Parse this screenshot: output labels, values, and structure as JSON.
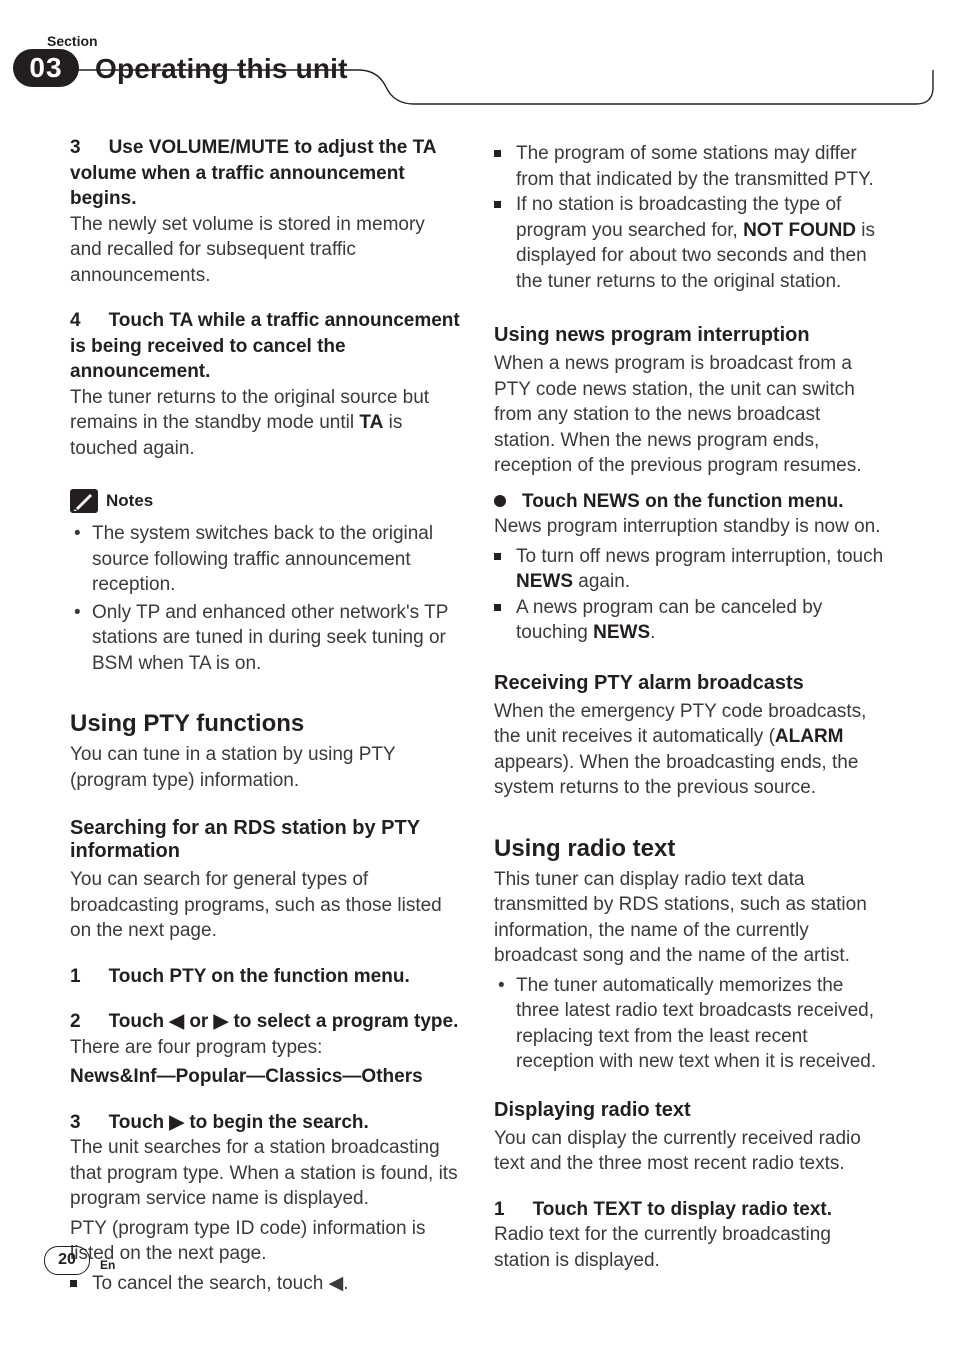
{
  "header": {
    "section_label": "Section",
    "section_number": "03",
    "title": "Operating this unit"
  },
  "left": {
    "step3_head": "Use VOLUME/MUTE to adjust the TA volume when a traffic announcement begins.",
    "step3_body": "The newly set volume is stored in memory and recalled for subsequent traffic announcements.",
    "step4_head": "Touch TA while a traffic announcement is being received to cancel the announcement.",
    "step4_body_a": "The tuner returns to the original source but remains in the standby mode until ",
    "step4_body_b": "TA",
    "step4_body_c": " is touched again.",
    "notes_label": "Notes",
    "notes": [
      "The system switches back to the original source following traffic announcement reception.",
      "Only TP and enhanced other network's TP stations are tuned in during seek tuning or BSM when TA is on."
    ],
    "h2_pty": "Using PTY functions",
    "pty_intro": "You can tune in a station by using PTY (program type) information.",
    "h3_search": "Searching for an RDS station by PTY information",
    "search_intro": "You can search for general types of broadcasting programs, such as those listed on the next page.",
    "s1": "Touch PTY on the function menu.",
    "s2": "Touch ◀ or ▶ to select a program type.",
    "s2_body": "There are four program types:",
    "s2_types": "News&Inf—Popular—Classics—Others",
    "s3": "Touch ▶ to begin the search.",
    "s3_body": "The unit searches for a station broadcasting that program type. When a station is found, its program service name is displayed.",
    "s3_body2": "PTY (program type ID code) information is listed on the next page.",
    "s3_cancel": "To cancel the search, touch ◀."
  },
  "right": {
    "sq1": "The program of some stations may differ from that indicated by the transmitted PTY.",
    "sq2_a": "If no station is broadcasting the type of program you searched for, ",
    "sq2_b": "NOT FOUND",
    "sq2_c": " is displayed for about two seconds and then the tuner returns to the original station.",
    "h3_news": "Using news program interruption",
    "news_body": "When a news program is broadcast from a PTY code news station, the unit can switch from any station to the news broadcast station. When the news program ends, reception of the previous program resumes.",
    "bb_news": "Touch NEWS on the function menu.",
    "news_after": "News program interruption standby is now on.",
    "sq3_a": "To turn off news program interruption, touch ",
    "sq3_b": "NEWS",
    "sq3_c": " again.",
    "sq4_a": "A news program can be canceled by touching ",
    "sq4_b": "NEWS",
    "sq4_c": ".",
    "h3_alarm": "Receiving PTY alarm broadcasts",
    "alarm_body_a": "When the emergency PTY code broadcasts, the unit receives it automatically (",
    "alarm_body_b": "ALARM",
    "alarm_body_c": " appears). When the broadcasting ends, the system returns to the previous source.",
    "h2_radio": "Using radio text",
    "radio_intro": "This tuner can display radio text data transmitted by RDS stations, such as station information, the name of the currently broadcast song and the name of the artist.",
    "radio_bullet": "The tuner automatically memorizes the three latest radio text broadcasts received, replacing text from the least recent reception with new text when it is received.",
    "h3_disp": "Displaying radio text",
    "disp_body": "You can display the currently received radio text and the three most recent radio texts.",
    "d1": "Touch TEXT to display radio text.",
    "d1_body": "Radio text for the currently broadcasting station is displayed."
  },
  "footer": {
    "page": "20",
    "lang": "En"
  }
}
